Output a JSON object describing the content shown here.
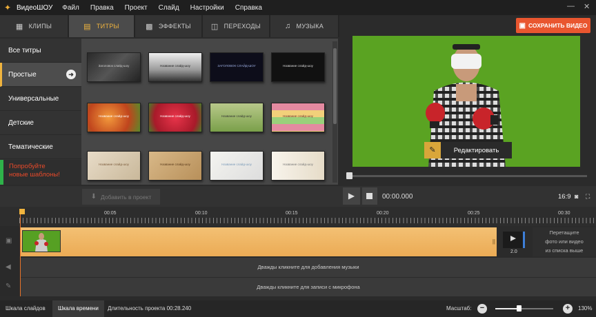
{
  "titlebar": {
    "app_name": "ВидеоШОУ",
    "menu": [
      "Файл",
      "Правка",
      "Проект",
      "Слайд",
      "Настройки",
      "Справка"
    ],
    "minimize": "—",
    "close": "✕"
  },
  "tabs": [
    {
      "label": "КЛИПЫ",
      "icon": "film-icon",
      "glyph": "▦"
    },
    {
      "label": "ТИТРЫ",
      "icon": "text-comment-icon",
      "glyph": "▤"
    },
    {
      "label": "ЭФФЕКТЫ",
      "icon": "effects-grid-icon",
      "glyph": "▩"
    },
    {
      "label": "ПЕРЕХОДЫ",
      "icon": "transition-icon",
      "glyph": "◫"
    },
    {
      "label": "МУЗЫКА",
      "icon": "music-note-icon",
      "glyph": "♫"
    }
  ],
  "active_tab": "ТИТРЫ",
  "save_button": {
    "label": "СОХРАНИТЬ ВИДЕО",
    "icon": "film-save-icon",
    "color": "#e9562f"
  },
  "sidebar": {
    "items": [
      {
        "label": "Все титры"
      },
      {
        "label": "Простые",
        "active": true
      },
      {
        "label": "Универсальные"
      },
      {
        "label": "Детские"
      },
      {
        "label": "Тематические"
      }
    ],
    "promo": {
      "line1": "Попробуйте",
      "line2": "новые шаблоны!",
      "color": "#e84a2a"
    }
  },
  "title_thumbs": [
    {
      "bg": "linear-gradient(135deg,#2a2a2a,#555 50%,#222)",
      "text": "Заголовок слайд-шоу",
      "color": "#ccc"
    },
    {
      "bg": "linear-gradient(#eee,#999 60%,#333)",
      "text": "Название слайд-шоу",
      "color": "#222"
    },
    {
      "bg": "#0d0d1a",
      "text": "ЗАГОЛОВОК СЛАЙД-ШОУ",
      "color": "#9ad"
    },
    {
      "bg": "#111",
      "text": "Название слайд-шоу",
      "color": "#ddd"
    },
    {
      "bg": "radial-gradient(circle at 40% 50%,#f39a3c,#c0451d 60%,#5a8a2a)",
      "text": "Название слайд-шоу",
      "color": "#fff"
    },
    {
      "bg": "radial-gradient(circle,#e8344a,#a81a2a 70%,#4a7a2a)",
      "text": "Название слайд-шоу",
      "color": "#fff"
    },
    {
      "bg": "linear-gradient(#b8c88a,#7aa04a)",
      "text": "Название слайд-шоу",
      "color": "#333"
    },
    {
      "bg": "repeating-linear-gradient(#e48aa0 0 10px,#f2d07a 10px 20px,#9ad07a 20px 30px)",
      "text": "Название слайд-шоу",
      "color": "#633"
    },
    {
      "bg": "linear-gradient(135deg,#e8dcc8,#c9b89a)",
      "text": "Название слайд-шоу",
      "color": "#7a5a3a"
    },
    {
      "bg": "linear-gradient(135deg,#d8b888,#b8905a)",
      "text": "Название слайд-шоу",
      "color": "#5a3a1a"
    },
    {
      "bg": "linear-gradient(135deg,#f4f4f0,#ddd)",
      "text": "Название слайд-шоу",
      "color": "#7a9ab8"
    },
    {
      "bg": "linear-gradient(90deg,#f8f4ec,#e6dcc8)",
      "text": "Название слайд-шоу",
      "color": "#777"
    }
  ],
  "add_to_project": {
    "label": "Добавить в проект",
    "icon": "download-icon"
  },
  "preview": {
    "edit_label": "Редактировать",
    "edit_icon": "pencil-icon",
    "timecode": "00:00.000",
    "aspect": "16:9",
    "seek_position": 0.0
  },
  "timeline": {
    "ruler_labels": [
      "00:05",
      "00:10",
      "00:15",
      "00:20",
      "00:25",
      "00:30"
    ],
    "transition_value": "2.0",
    "drop_hint": [
      "Перетащите",
      "фото или видео",
      "из списка выше"
    ],
    "music_hint": "Дважды кликните для добавления музыки",
    "mic_hint": "Дважды кликните для записи с микрофона"
  },
  "statusbar": {
    "slides_view": "Шкала слайдов",
    "timeline_view": "Шкала времени",
    "duration": "Длительность проекта 00:28.240",
    "zoom_label": "Масштаб:",
    "zoom_value": "130%",
    "zoom_level": 0.4
  }
}
